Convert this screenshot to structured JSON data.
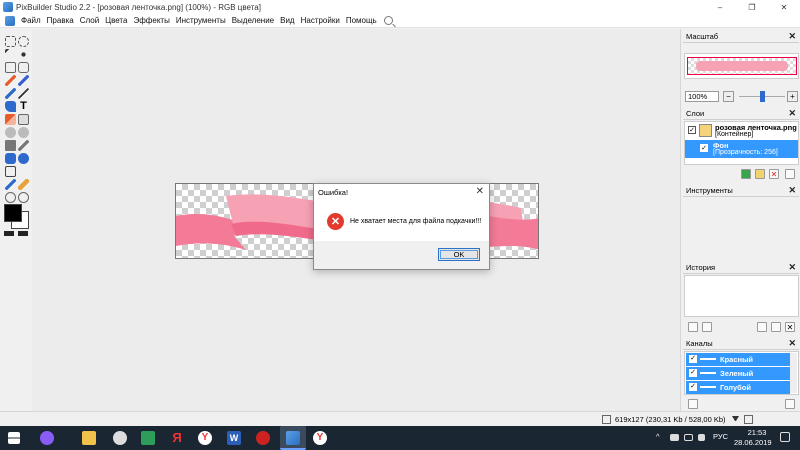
{
  "window": {
    "title": "PixBuilder Studio 2.2 - [розовая ленточка.png] (100%) - RGB цвета]",
    "minimize": "–",
    "maximize": "❐",
    "close": "✕"
  },
  "menu": [
    "Файл",
    "Правка",
    "Слой",
    "Цвета",
    "Эффекты",
    "Инструменты",
    "Выделение",
    "Вид",
    "Настройки",
    "Помощь"
  ],
  "dialog": {
    "title": "Ошибка!",
    "close": "✕",
    "message": "Не хватает места для файла подкачки!!!",
    "ok_label": "OK",
    "icon": "error-icon"
  },
  "panels": {
    "zoom": {
      "header": "Масштаб",
      "close": "✕",
      "value": "100%",
      "minus": "−",
      "plus": "+",
      "slider_level": 0.5
    },
    "layers": {
      "header": "Слои",
      "close": "✕",
      "items": [
        {
          "name": "розовая ленточка.png",
          "sub": "[Контейнер]"
        },
        {
          "name": "Фон",
          "sub": "[Прозрачность: 256]"
        }
      ]
    },
    "tools": {
      "header": "Инструменты",
      "close": "✕"
    },
    "history": {
      "header": "История",
      "close": "✕"
    },
    "channels": {
      "header": "Каналы",
      "close": "✕",
      "items": [
        "Красный",
        "Зеленый",
        "Голубой"
      ]
    }
  },
  "status": {
    "text": "619x127  (230,31 Kb / 528,00 Kb)"
  },
  "taskbar": {
    "lang": "РУС",
    "time": "21:53",
    "date": "28.06.2019"
  },
  "colors": {
    "accent": "#3399ff",
    "ribbon": "#f47b98",
    "taskbar": "#1b2633",
    "error": "#e23a2e"
  }
}
